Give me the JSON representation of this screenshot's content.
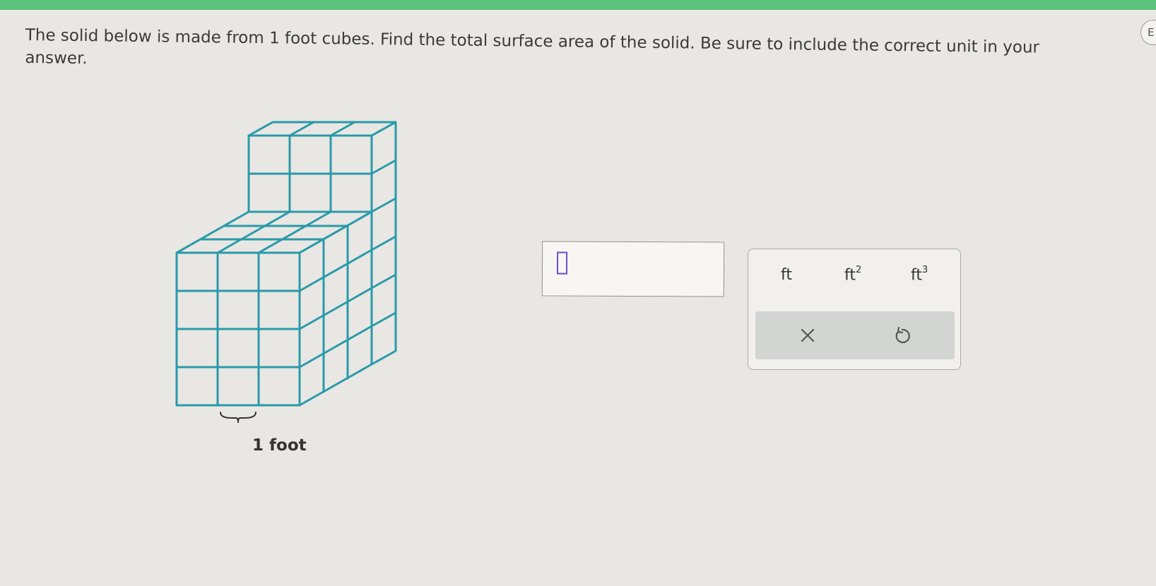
{
  "question": {
    "text": "The solid below is made from 1 foot cubes. Find the total surface area of the solid. Be sure to include the correct unit in your answer."
  },
  "figure": {
    "scale_label": "1 foot"
  },
  "answer": {
    "value": ""
  },
  "units": {
    "ft": {
      "base": "ft",
      "exp": ""
    },
    "ft2": {
      "base": "ft",
      "exp": "2"
    },
    "ft3": {
      "base": "ft",
      "exp": "3"
    }
  },
  "side_tab": {
    "label": "E"
  },
  "colors": {
    "accent_bar": "#5cc47a",
    "cube_lines": "#2a9aaa",
    "cursor": "#6c4fc7"
  },
  "icons": {
    "clear": "close-icon",
    "undo": "undo-icon"
  }
}
